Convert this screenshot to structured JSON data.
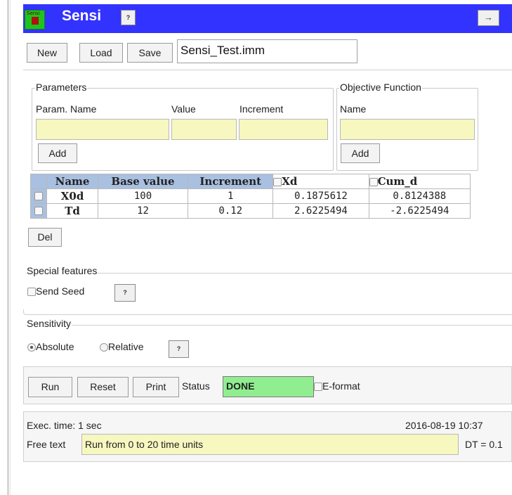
{
  "app": {
    "title": "Sensi",
    "help_label": "?",
    "collapse_icon": "right-arrow-icon",
    "collapse_glyph": "→",
    "logo_text": "Sensi"
  },
  "toolbar": {
    "new_label": "New",
    "load_label": "Load",
    "save_label": "Save",
    "filename": "Sensi_Test.imm"
  },
  "parameters": {
    "legend": "Parameters",
    "col_name": "Param. Name",
    "col_value": "Value",
    "col_increment": "Increment",
    "name_value": "",
    "value_value": "",
    "increment_value": "",
    "add_label": "Add"
  },
  "objective": {
    "legend": "Objective Function",
    "col_name": "Name",
    "name_value": "",
    "add_label": "Add"
  },
  "table": {
    "headers": [
      "Name",
      "Base value",
      "Increment",
      "Xd",
      "Cum_d"
    ],
    "rows": [
      {
        "name": "X0d",
        "base": "100",
        "increment": "1",
        "xd": "0.1875612",
        "cum_d": "0.8124388"
      },
      {
        "name": "Td",
        "base": "12",
        "increment": "0.12",
        "xd": "2.6225494",
        "cum_d": "-2.6225494"
      }
    ],
    "del_label": "Del"
  },
  "special": {
    "legend": "Special features",
    "send_seed_label": "Send Seed",
    "help_label": "?"
  },
  "sensitivity": {
    "legend": "Sensitivity",
    "absolute_label": "Absolute",
    "relative_label": "Relative",
    "selected": "Absolute",
    "help_label": "?"
  },
  "run": {
    "run_label": "Run",
    "reset_label": "Reset",
    "print_label": "Print",
    "status_label": "Status",
    "status_value": "DONE",
    "eformat_label": "E-format",
    "status_color": "#90ee90"
  },
  "footer": {
    "exec_time": "Exec. time: 1 sec",
    "timestamp": "2016-08-19 10:37",
    "free_text_label": "Free text",
    "free_text_value": "Run from 0 to 20 time units",
    "dt": "DT = 0.1"
  },
  "colors": {
    "title_bar": "#3333ff",
    "header_cell": "#a9c0e0",
    "input_yellow": "#f7f7c0",
    "status_done": "#90ee90"
  }
}
